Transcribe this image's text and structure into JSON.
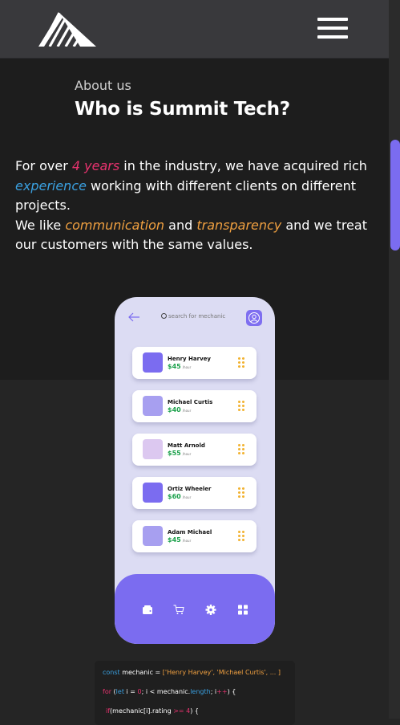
{
  "header": {
    "logo": "summit-tech-logo",
    "menu_icon": "hamburger-icon"
  },
  "about": {
    "eyebrow": "About us",
    "title": "Who is Summit Tech?",
    "para1": {
      "p1": "For over ",
      "years": "4 years",
      "p2": " in the industry, we have acquired rich ",
      "experience": "experience",
      "p3": " working with different clients on different projects."
    },
    "para2": {
      "p1": "We like ",
      "communication": "communication",
      "p2": " and ",
      "transparency": "transparency",
      "p3": " and we treat our customers with the same values."
    }
  },
  "phone": {
    "search_placeholder": "search for mechanic",
    "mechanics": [
      {
        "name": "Henry Harvey",
        "price": "$45",
        "unit": "/hour",
        "color": "#7b6cf0"
      },
      {
        "name": "Michael Curtis",
        "price": "$40",
        "unit": "/hour",
        "color": "#a79ff0"
      },
      {
        "name": "Matt Arnold",
        "price": "$55",
        "unit": "/hour",
        "color": "#dcc8f0"
      },
      {
        "name": "Ortiz Wheeler",
        "price": "$60",
        "unit": "/hour",
        "color": "#7b6cf0"
      },
      {
        "name": "Adam Michael",
        "price": "$45",
        "unit": "/hour",
        "color": "#a79ff0"
      }
    ],
    "nav": [
      "wallet-icon",
      "cart-icon",
      "settings-icon",
      "grid-icon"
    ]
  },
  "code": {
    "line1": {
      "kw": "const",
      "var": " mechanic = ",
      "arr": "['Henry Harvey', 'Michael Curtis', ... ]"
    },
    "line2": {
      "kw": "for",
      "rest1": " (",
      "let": "let",
      "rest2": " i = ",
      "zero": "0",
      "rest3": "; i < mechanic.",
      "len": "length",
      "rest4": "; i",
      "pp": "++",
      "rest5": ") {"
    },
    "line3": {
      "kw": "if",
      "rest1": "(mechanic[i].rating ",
      "op": ">= 4",
      "rest2": ") {"
    }
  },
  "colors": {
    "accent": "#7b6cf0",
    "pink": "#e8336f",
    "blue": "#3aa0e0",
    "orange": "#f0a040"
  }
}
